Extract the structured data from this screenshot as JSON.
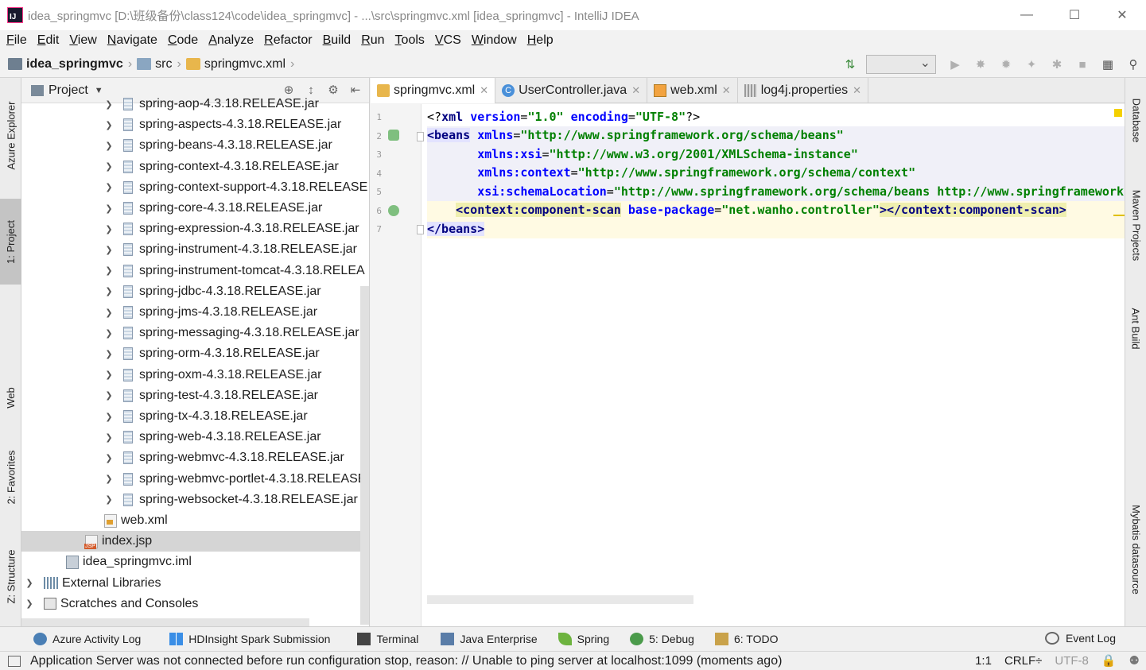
{
  "window": {
    "title": "idea_springmvc [D:\\班级备份\\class124\\code\\idea_springmvc] - ...\\src\\springmvc.xml [idea_springmvc] - IntelliJ IDEA",
    "app_icon_label": "IJ"
  },
  "menu": [
    "File",
    "Edit",
    "View",
    "Navigate",
    "Code",
    "Analyze",
    "Refactor",
    "Build",
    "Run",
    "Tools",
    "VCS",
    "Window",
    "Help"
  ],
  "breadcrumb": {
    "project": "idea_springmvc",
    "folder": "src",
    "file": "springmvc.xml"
  },
  "left_strip": {
    "azure_explorer": "Azure Explorer",
    "project": "1: Project",
    "web": "Web",
    "favorites": "2: Favorites",
    "structure": "Z: Structure"
  },
  "right_strip": {
    "database": "Database",
    "maven": "Maven Projects",
    "ant": "Ant Build",
    "mybatis": "Mybatis datasource"
  },
  "project_panel": {
    "title": "Project",
    "partial_top_item": "spring-aop-4.3.18.RELEASE.jar",
    "jars": [
      "spring-aspects-4.3.18.RELEASE.jar",
      "spring-beans-4.3.18.RELEASE.jar",
      "spring-context-4.3.18.RELEASE.jar",
      "spring-context-support-4.3.18.RELEASE",
      "spring-core-4.3.18.RELEASE.jar",
      "spring-expression-4.3.18.RELEASE.jar",
      "spring-instrument-4.3.18.RELEASE.jar",
      "spring-instrument-tomcat-4.3.18.RELEA",
      "spring-jdbc-4.3.18.RELEASE.jar",
      "spring-jms-4.3.18.RELEASE.jar",
      "spring-messaging-4.3.18.RELEASE.jar",
      "spring-orm-4.3.18.RELEASE.jar",
      "spring-oxm-4.3.18.RELEASE.jar",
      "spring-test-4.3.18.RELEASE.jar",
      "spring-tx-4.3.18.RELEASE.jar",
      "spring-web-4.3.18.RELEASE.jar",
      "spring-webmvc-4.3.18.RELEASE.jar",
      "spring-webmvc-portlet-4.3.18.RELEASE",
      "spring-websocket-4.3.18.RELEASE.jar"
    ],
    "web_xml": "web.xml",
    "index_jsp": "index.jsp",
    "iml": "idea_springmvc.iml",
    "external_libraries": "External Libraries",
    "scratches": "Scratches and Consoles"
  },
  "editor_tabs": [
    {
      "label": "springmvc.xml",
      "icon": "xml-icon",
      "active": true
    },
    {
      "label": "UserController.java",
      "icon": "java-class-icon",
      "active": false
    },
    {
      "label": "web.xml",
      "icon": "web-xml-icon",
      "active": false
    },
    {
      "label": "log4j.properties",
      "icon": "properties-icon",
      "active": false
    }
  ],
  "editor": {
    "line_numbers": [
      "1",
      "2",
      "3",
      "4",
      "5",
      "6",
      "7"
    ],
    "lines": {
      "l1": {
        "pi_open": "<?",
        "name": "xml",
        "attr1": "version",
        "val1": "\"1.0\"",
        "attr2": "encoding",
        "val2": "\"UTF-8\"",
        "pi_close": "?>"
      },
      "l2": {
        "lt": "<",
        "tag": "beans",
        "attr": "xmlns",
        "val": "\"http://www.springframework.org/schema/beans\""
      },
      "l3": {
        "attr": "xmlns:xsi",
        "val": "\"http://www.w3.org/2001/XMLSchema-instance\""
      },
      "l4": {
        "attr": "xmlns:context",
        "val": "\"http://www.springframework.org/schema/context\""
      },
      "l5": {
        "attr": "xsi:schemaLocation",
        "val": "\"http://www.springframework.org/schema/beans http://www.springframework."
      },
      "l6": {
        "open": "<context:component-scan",
        "attr": "base-package",
        "val": "\"net.wanho.controller\"",
        "close": "></context:component-scan>"
      },
      "l7": {
        "tag": "</beans>"
      }
    }
  },
  "bottom_tabs": [
    {
      "label": "Azure Activity Log",
      "icon": "azure-gear-icon"
    },
    {
      "label": "HDInsight Spark Submission",
      "icon": "windows-icon"
    },
    {
      "label": "Terminal",
      "icon": "terminal-icon"
    },
    {
      "label": "Java Enterprise",
      "icon": "java-enterprise-icon"
    },
    {
      "label": "Spring",
      "icon": "spring-leaf-icon"
    },
    {
      "label": "5: Debug",
      "icon": "bug-icon"
    },
    {
      "label": "6: TODO",
      "icon": "todo-icon"
    }
  ],
  "event_log": "Event Log",
  "status": {
    "message": "Application Server was not connected before run configuration stop, reason: // Unable to ping server at localhost:1099 (moments ago)",
    "position": "1:1",
    "line_sep": "CRLF÷",
    "encoding": "UTF-8"
  },
  "colors": {
    "xml_tag": "#000080",
    "xml_attr": "#0000ff",
    "xml_value": "#008000",
    "selection": "#d5d5d5"
  }
}
